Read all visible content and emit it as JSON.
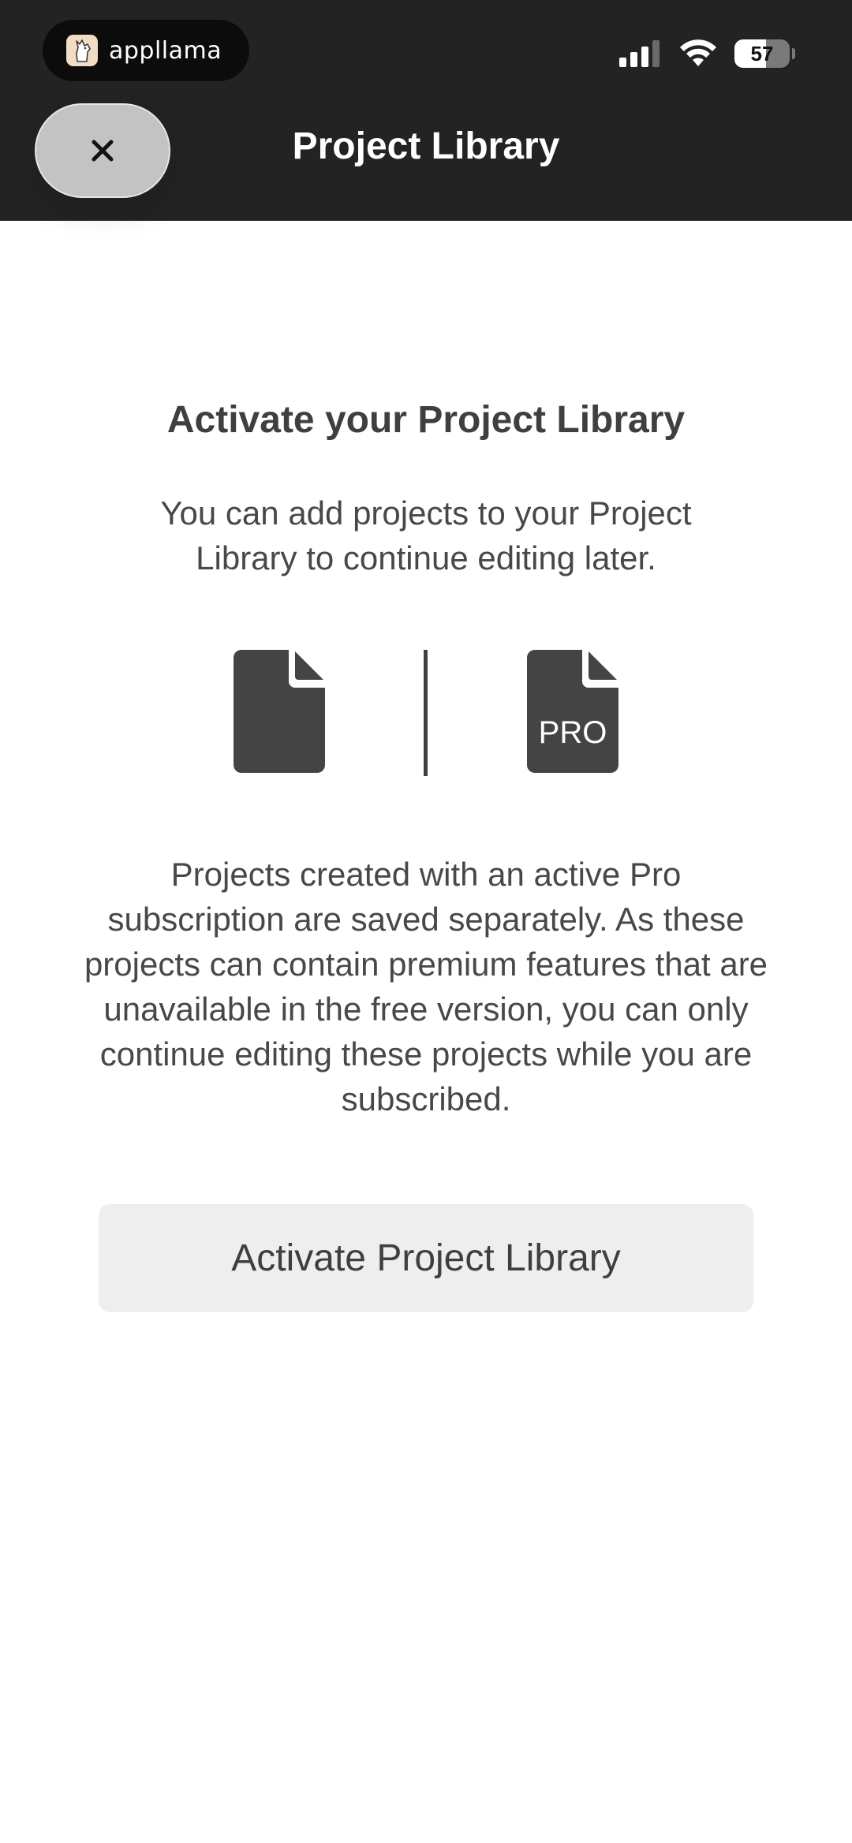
{
  "status_bar": {
    "app_name": "appllama",
    "battery_level": "57",
    "battery_fraction": 0.57,
    "icons": [
      "cellular-signal-icon",
      "wifi-icon",
      "battery-icon"
    ]
  },
  "header": {
    "title": "Project Library",
    "close_icon": "close-icon",
    "close_symbol": "×",
    "background": "#232323"
  },
  "main": {
    "heading": "Activate your Project Library",
    "intro": "You can add projects to your Project Library to continue editing later.",
    "icons": {
      "free_document": "document-icon",
      "pro_document": "pro-document-icon",
      "pro_label": "PRO"
    },
    "description": "Projects created with an active Pro subscription are saved separately. As these projects can contain premium features that are unavailable in the free version, you can only continue editing these projects while you are subscribed.",
    "button_label": "Activate Project Library"
  }
}
